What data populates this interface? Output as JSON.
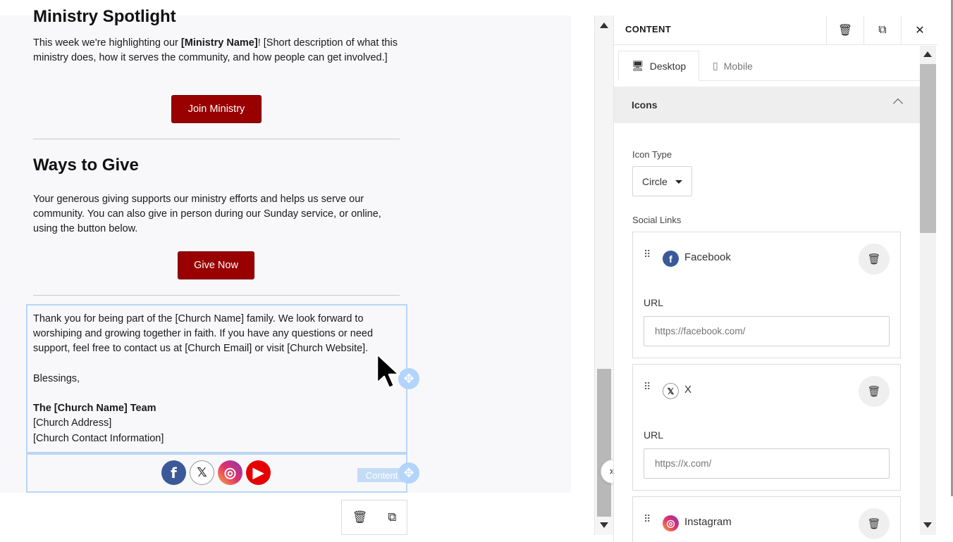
{
  "email": {
    "clipped_heading": "Ministry Spotlight",
    "ministry_text_1": "This week we're highlighting our ",
    "ministry_name": "[Ministry Name]",
    "ministry_text_2": "! [Short description of what this ministry does, how it serves the community, and how people can get involved.]",
    "join_button": "Join Ministry",
    "give_title": "Ways to Give",
    "give_text": "Your generous giving supports our ministry efforts and helps us serve our community. You can also give in person during our Sunday service, or online, using the button below.",
    "give_button": "Give Now",
    "closing_text": "Thank you for being part of the [Church Name] family. We look forward to worshiping and growing together in faith. If you have any questions or need support, feel free to contact us at [Church Email] or visit [Church Website].",
    "signoff": "Blessings,",
    "team": "The [Church Name] Team",
    "address": "[Church Address]",
    "contact": "[Church Contact Information]",
    "content_tag": "Content",
    "social_icons": [
      "facebook-icon",
      "x-icon",
      "instagram-icon",
      "youtube-icon"
    ],
    "social_glyphs": {
      "facebook": "f",
      "x": "𝕏",
      "instagram": "◎",
      "youtube": "▶"
    }
  },
  "panel": {
    "title": "CONTENT",
    "tabs": [
      {
        "label": "Desktop",
        "icon": "desktop-icon",
        "active": true
      },
      {
        "label": "Mobile",
        "icon": "mobile-icon",
        "active": false
      }
    ],
    "section": "Icons",
    "icon_type_label": "Icon Type",
    "icon_type_value": "Circle",
    "social_links_label": "Social Links",
    "links": [
      {
        "name": "Facebook",
        "icon": "facebook-icon",
        "glyph": "f",
        "url_label": "URL",
        "url_placeholder": "https://facebook.com/"
      },
      {
        "name": "X",
        "icon": "x-icon",
        "glyph": "𝕏",
        "url_label": "URL",
        "url_placeholder": "https://x.com/"
      },
      {
        "name": "Instagram",
        "icon": "instagram-icon",
        "glyph": "◎"
      }
    ]
  },
  "colors": {
    "brand_button": "#990000",
    "selection": "#b9d6f5",
    "facebook": "#3b5998",
    "youtube": "#e60000"
  }
}
